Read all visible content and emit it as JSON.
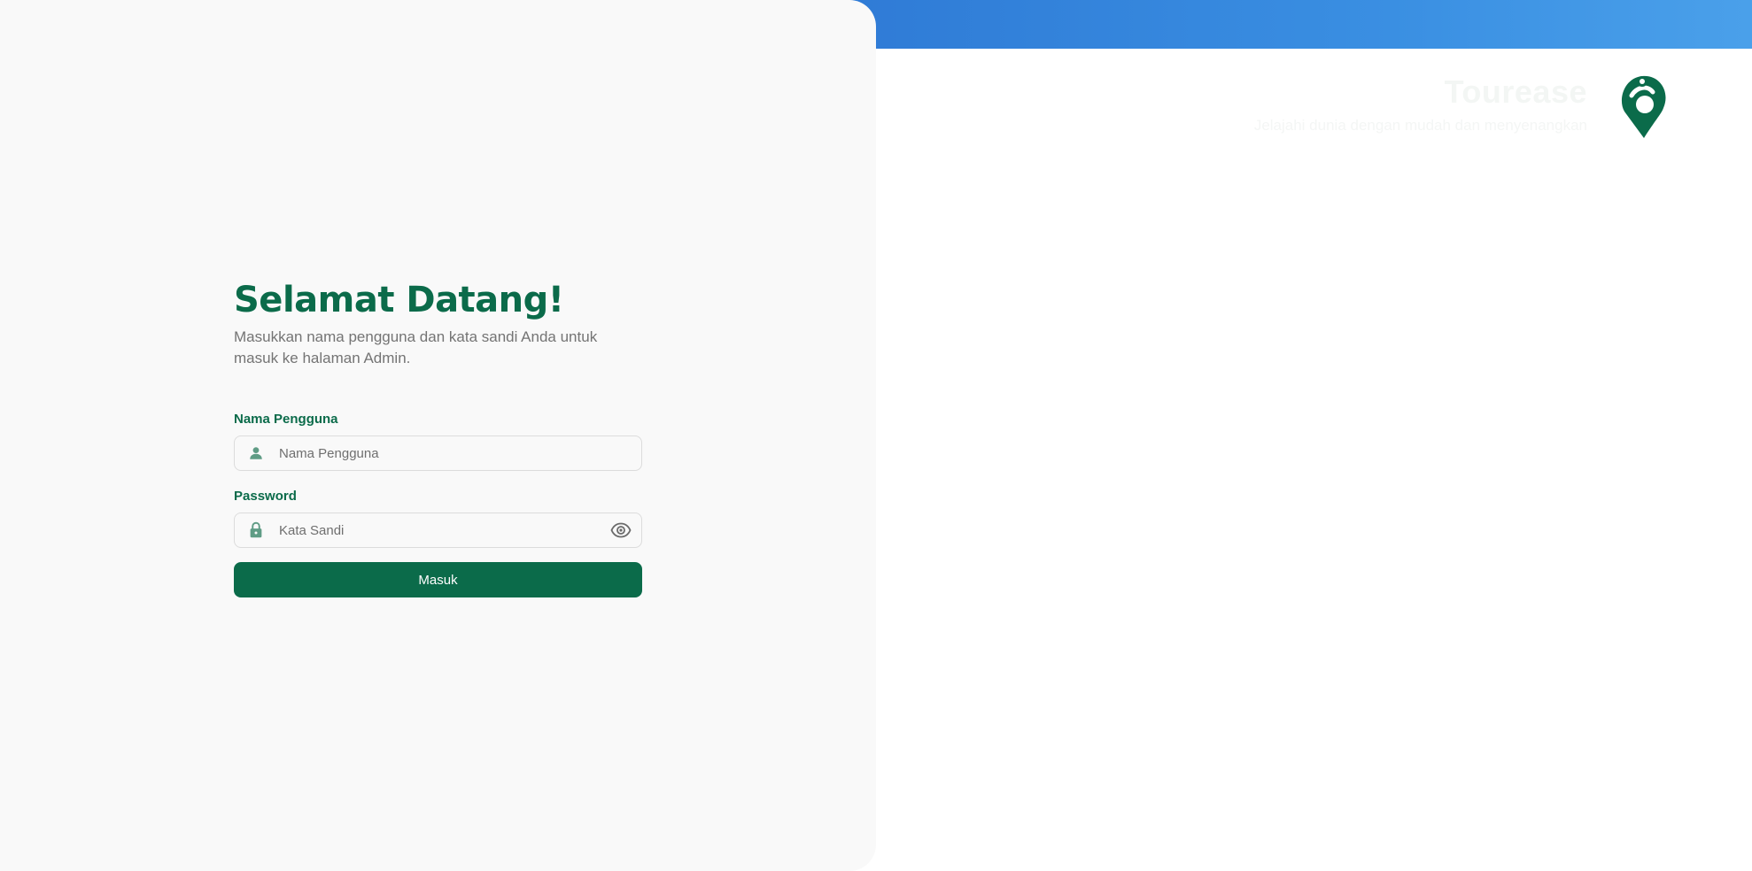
{
  "brand": {
    "name": "Tourease",
    "tagline": "Jelajahi dunia dengan mudah dan menyenangkan",
    "accent_color": "#0b6b4a",
    "logo_icon": "location-pin-logo-icon"
  },
  "login": {
    "title": "Selamat Datang!",
    "subtitle": "Masukkan nama pengguna dan kata sandi Anda untuk masuk ke halaman Admin.",
    "username": {
      "label": "Nama Pengguna",
      "placeholder": "Nama Pengguna",
      "value": "",
      "icon": "user-icon"
    },
    "password": {
      "label": "Password",
      "placeholder": "Kata Sandi",
      "value": "",
      "icon": "lock-icon",
      "toggle_icon": "eye-icon"
    },
    "submit_label": "Masuk"
  },
  "colors": {
    "primary": "#0b6b4a",
    "header_gradient_start": "#2f7bd6",
    "header_gradient_end": "#4aa0ea",
    "panel_background": "#f9f9f9"
  }
}
